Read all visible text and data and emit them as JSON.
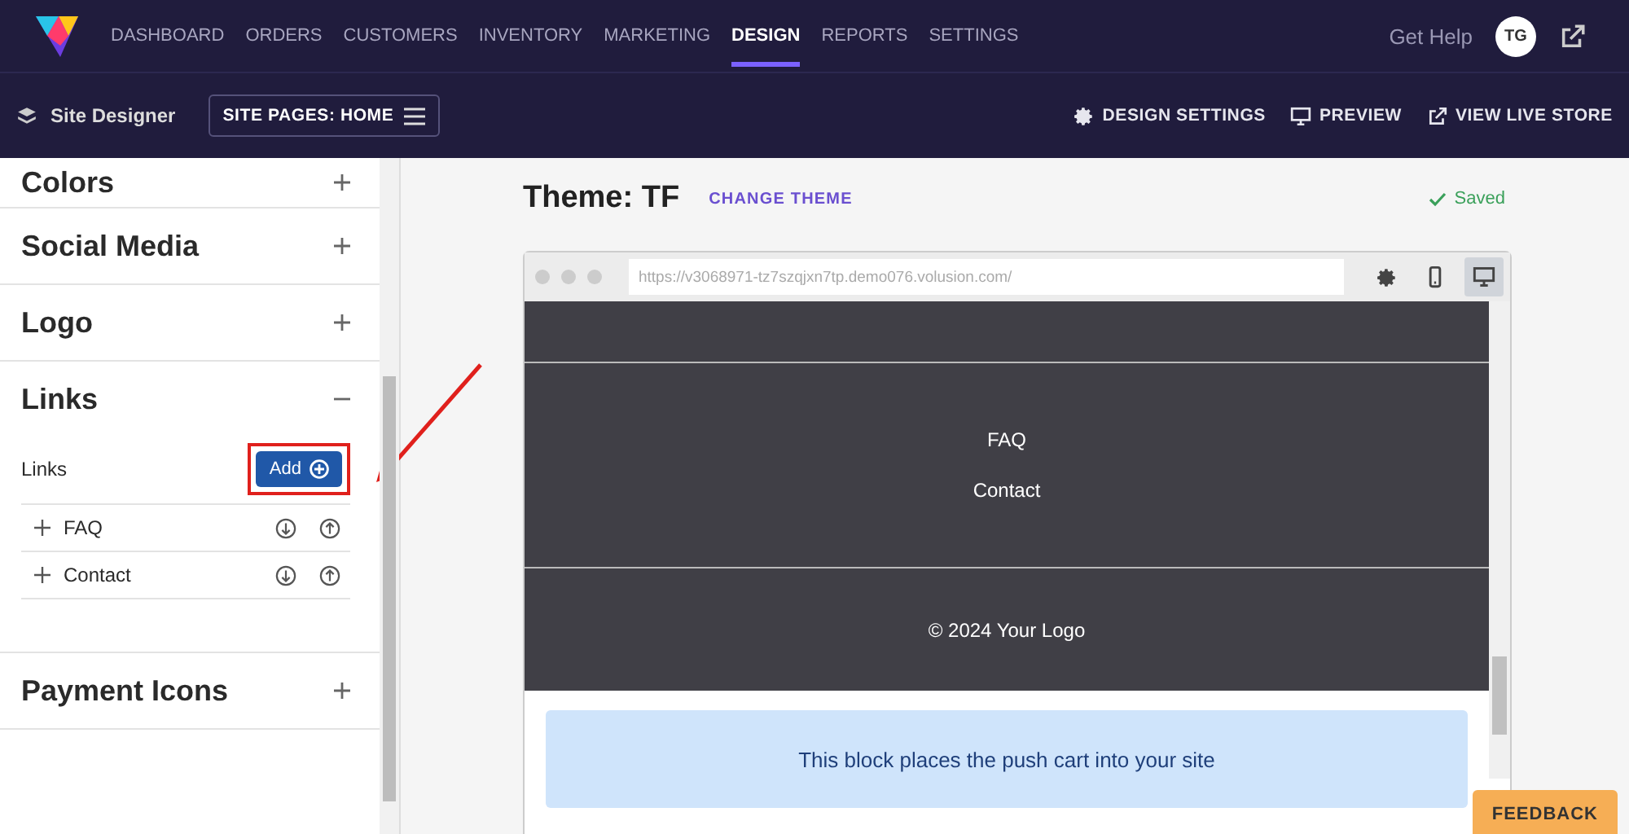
{
  "nav": {
    "items": [
      {
        "label": "DASHBOARD",
        "selected": false
      },
      {
        "label": "ORDERS",
        "selected": false
      },
      {
        "label": "CUSTOMERS",
        "selected": false
      },
      {
        "label": "INVENTORY",
        "selected": false
      },
      {
        "label": "MARKETING",
        "selected": false
      },
      {
        "label": "DESIGN",
        "selected": true
      },
      {
        "label": "REPORTS",
        "selected": false
      },
      {
        "label": "SETTINGS",
        "selected": false
      }
    ],
    "help": "Get Help",
    "avatar": "TG"
  },
  "subbar": {
    "title": "Site Designer",
    "pages_button": "SITE PAGES: HOME",
    "actions": [
      {
        "kind": "settings",
        "label": "DESIGN SETTINGS"
      },
      {
        "kind": "preview",
        "label": "PREVIEW"
      },
      {
        "kind": "external",
        "label": "VIEW LIVE STORE"
      }
    ]
  },
  "sidebar": {
    "sections": [
      {
        "title": "Colors",
        "expanded": false
      },
      {
        "title": "Social Media",
        "expanded": false
      },
      {
        "title": "Logo",
        "expanded": false
      },
      {
        "title": "Links",
        "expanded": true,
        "list_label": "Links",
        "add_button": {
          "label": "Add",
          "highlighted": true
        },
        "children": [
          {
            "label": "FAQ"
          },
          {
            "label": "Contact"
          }
        ]
      },
      {
        "title": "Payment Icons",
        "expanded": false
      }
    ]
  },
  "theme": {
    "title": "Theme: TF",
    "change_link": "CHANGE THEME",
    "status": "Saved"
  },
  "preview": {
    "url": "https://v3068971-tz7szqjxn7tp.demo076.volusion.com/",
    "tools": [
      {
        "kind": "settings",
        "selected": false
      },
      {
        "kind": "mobile",
        "selected": false
      },
      {
        "kind": "desktop",
        "selected": true
      }
    ],
    "footer_links": [
      "FAQ",
      "Contact"
    ],
    "copyright": "© 2024 Your Logo",
    "cart_block": "This block places the push cart into your site"
  },
  "feedback": "FEEDBACK"
}
